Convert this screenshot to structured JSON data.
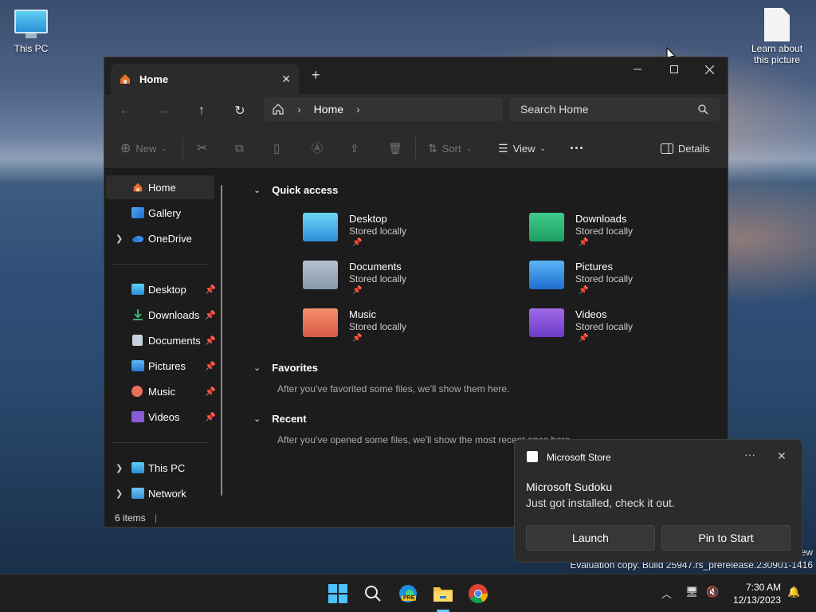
{
  "desktop": {
    "this_pc_label": "This PC",
    "learn_picture_label": "Learn about this picture",
    "watermark_line1": "ew",
    "watermark_line2": "Evaluation copy. Build 25947.rs_prerelease.230901-1416"
  },
  "explorer": {
    "tab_title": "Home",
    "tab_close": "✕",
    "new_tab": "+",
    "breadcrumb": "Home",
    "search_placeholder": "Search Home",
    "toolbar": {
      "new_label": "New",
      "sort_label": "Sort",
      "view_label": "View",
      "details_label": "Details"
    },
    "sidebar": {
      "top_items": [
        {
          "label": "Home"
        },
        {
          "label": "Gallery"
        },
        {
          "label": "OneDrive"
        }
      ],
      "pinned_items": [
        {
          "label": "Desktop"
        },
        {
          "label": "Downloads"
        },
        {
          "label": "Documents"
        },
        {
          "label": "Pictures"
        },
        {
          "label": "Music"
        },
        {
          "label": "Videos"
        }
      ],
      "bottom_items": [
        {
          "label": "This PC"
        },
        {
          "label": "Network"
        }
      ]
    },
    "sections": {
      "quick_access": "Quick access",
      "favorites": "Favorites",
      "favorites_empty": "After you've favorited some files, we'll show them here.",
      "recent": "Recent",
      "recent_empty": "After you've opened some files, we'll show the most recent ones here."
    },
    "quick_access": [
      {
        "name": "Desktop",
        "sub": "Stored locally"
      },
      {
        "name": "Downloads",
        "sub": "Stored locally"
      },
      {
        "name": "Documents",
        "sub": "Stored locally"
      },
      {
        "name": "Pictures",
        "sub": "Stored locally"
      },
      {
        "name": "Music",
        "sub": "Stored locally"
      },
      {
        "name": "Videos",
        "sub": "Stored locally"
      }
    ],
    "status": "6 items"
  },
  "toast": {
    "app_name": "Microsoft Store",
    "title": "Microsoft Sudoku",
    "body": "Just got installed, check it out.",
    "launch_label": "Launch",
    "pin_label": "Pin to Start"
  },
  "taskbar": {
    "time": "7:30 AM",
    "date": "12/13/2023",
    "edge_badge": "PRE"
  },
  "colors": {
    "accent": "#60cdff",
    "window_bg": "#1c1c1c",
    "pane_bg": "#2b2b2b"
  }
}
